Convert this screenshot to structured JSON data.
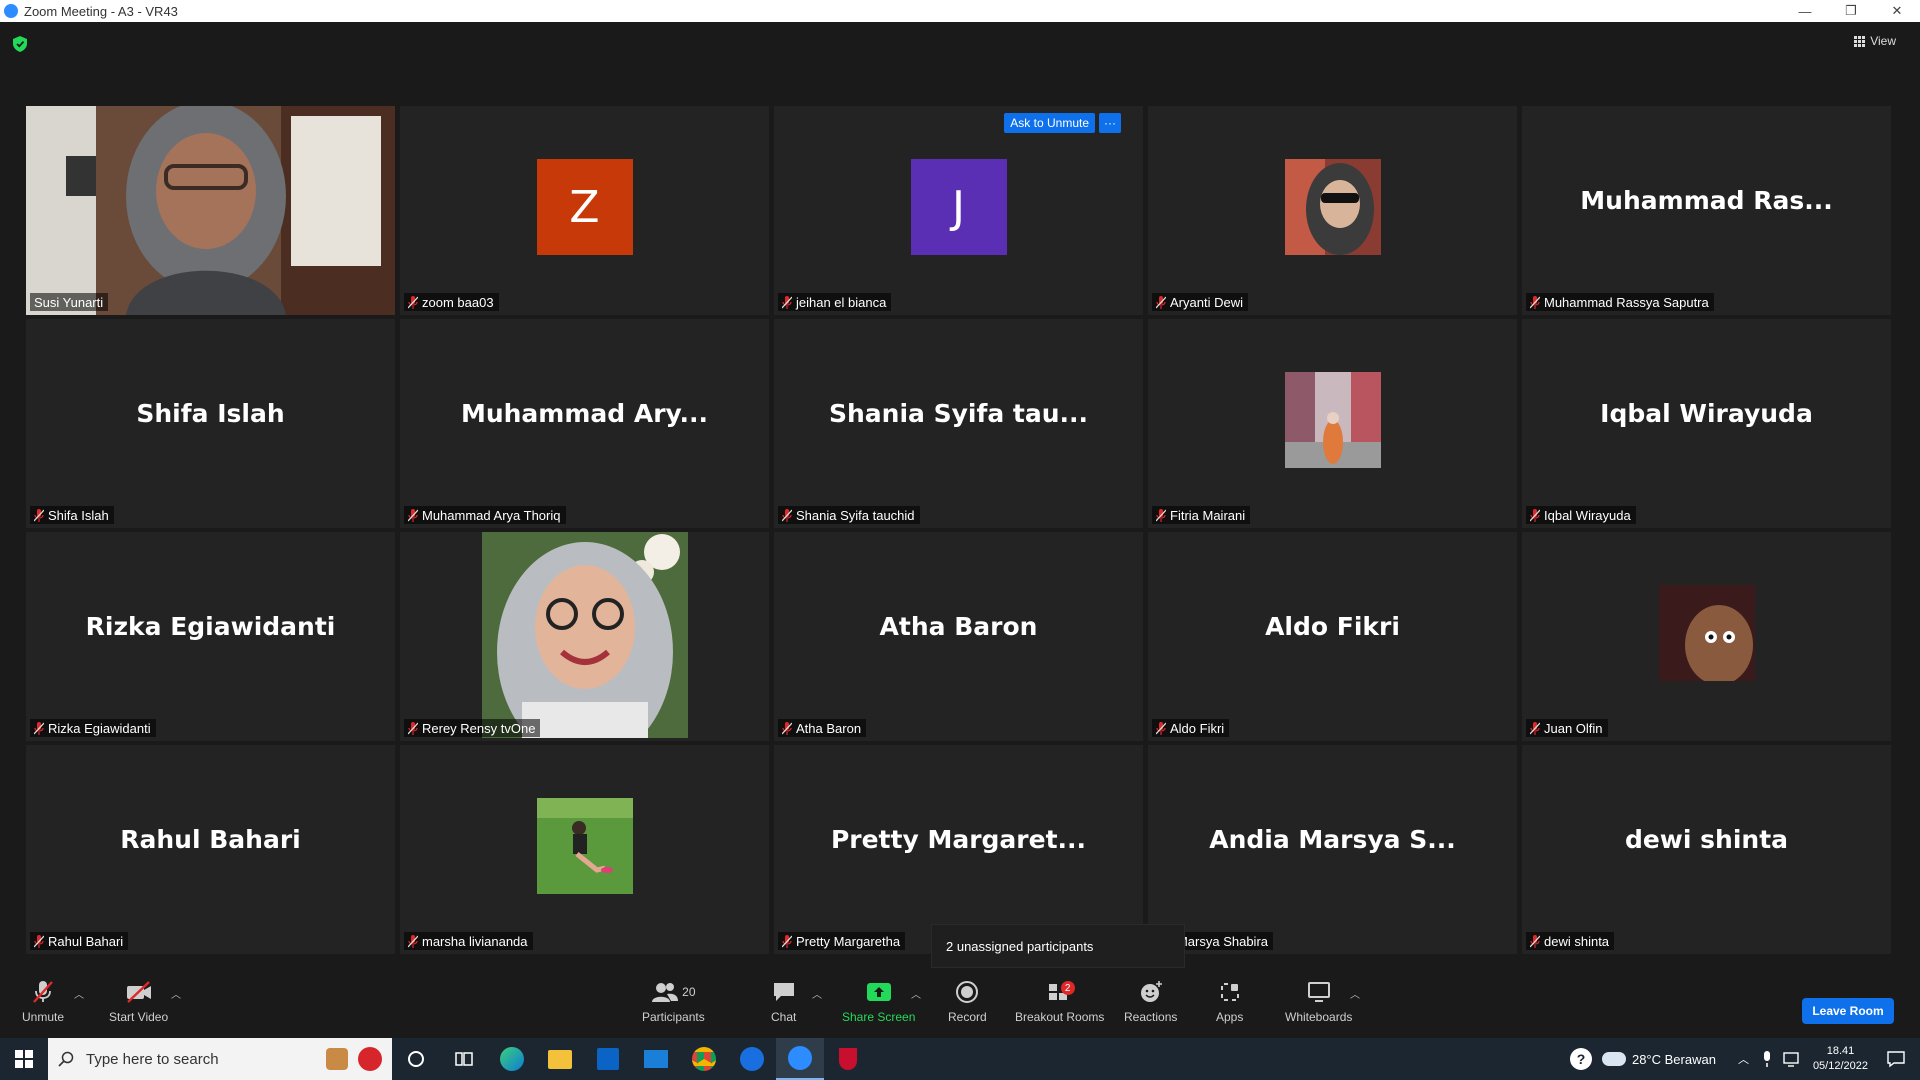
{
  "window": {
    "title": "Zoom Meeting - A3 - VR43",
    "minimize": "—",
    "restore": "❐",
    "close": "✕"
  },
  "view_label": "View",
  "tile_actions": {
    "ask_to_unmute": "Ask to Unmute",
    "more": "···"
  },
  "participants": [
    {
      "name": "Susi Yunarti",
      "display": "",
      "avatar_letter": "",
      "avatar_color": "",
      "muted": false,
      "active_speaker": true,
      "photo": "video"
    },
    {
      "name": "zoom baa03",
      "display": "",
      "avatar_letter": "Z",
      "avatar_color": "#c8390a",
      "muted": true,
      "photo": ""
    },
    {
      "name": "jeihan el bianca",
      "display": "",
      "avatar_letter": "J",
      "avatar_color": "#5b2fb4",
      "muted": true,
      "photo": ""
    },
    {
      "name": "Aryanti Dewi",
      "display": "",
      "avatar_letter": "",
      "avatar_color": "",
      "muted": true,
      "photo": "selfie"
    },
    {
      "name": "Muhammad Rassya Saputra",
      "display": "Muhammad  Ras...",
      "avatar_letter": "",
      "avatar_color": "",
      "muted": true,
      "photo": ""
    },
    {
      "name": "Shifa Islah",
      "display": "Shifa Islah",
      "avatar_letter": "",
      "avatar_color": "",
      "muted": true,
      "photo": ""
    },
    {
      "name": "Muhammad Arya Thoriq",
      "display": "Muhammad  Ary...",
      "avatar_letter": "",
      "avatar_color": "",
      "muted": true,
      "photo": ""
    },
    {
      "name": "Shania Syifa tauchid",
      "display": "Shania Syifa tau...",
      "avatar_letter": "",
      "avatar_color": "",
      "muted": true,
      "photo": ""
    },
    {
      "name": "Fitria Mairani",
      "display": "",
      "avatar_letter": "",
      "avatar_color": "",
      "muted": true,
      "photo": "street"
    },
    {
      "name": "Iqbal Wirayuda",
      "display": "Iqbal Wirayuda",
      "avatar_letter": "",
      "avatar_color": "",
      "muted": true,
      "photo": ""
    },
    {
      "name": "Rizka Egiawidanti",
      "display": "Rizka Egiawidanti",
      "avatar_letter": "",
      "avatar_color": "",
      "muted": true,
      "photo": ""
    },
    {
      "name": "Rerey Rensy tvOne",
      "display": "",
      "avatar_letter": "",
      "avatar_color": "",
      "muted": true,
      "photo": "portrait"
    },
    {
      "name": "Atha Baron",
      "display": "Atha Baron",
      "avatar_letter": "",
      "avatar_color": "",
      "muted": true,
      "photo": ""
    },
    {
      "name": "Aldo Fikri",
      "display": "Aldo Fikri",
      "avatar_letter": "",
      "avatar_color": "",
      "muted": true,
      "photo": ""
    },
    {
      "name": "Juan Olfin",
      "display": "",
      "avatar_letter": "",
      "avatar_color": "",
      "muted": true,
      "photo": "face"
    },
    {
      "name": "Rahul Bahari",
      "display": "Rahul Bahari",
      "avatar_letter": "",
      "avatar_color": "",
      "muted": true,
      "photo": ""
    },
    {
      "name": "marsha liviananda",
      "display": "",
      "avatar_letter": "",
      "avatar_color": "",
      "muted": true,
      "photo": "grass"
    },
    {
      "name": "Pretty Margaretha",
      "display": "Pretty  Margaret...",
      "avatar_letter": "",
      "avatar_color": "",
      "muted": true,
      "photo": ""
    },
    {
      "name": "dia Marsya Shabira",
      "display": "Andia Marsya S...",
      "avatar_letter": "",
      "avatar_color": "",
      "muted": false,
      "photo": ""
    },
    {
      "name": "dewi shinta",
      "display": "dewi shinta",
      "avatar_letter": "",
      "avatar_color": "",
      "muted": true,
      "photo": ""
    }
  ],
  "tooltip": "2 unassigned participants",
  "toolbar": {
    "unmute": "Unmute",
    "start_video": "Start Video",
    "participants": "Participants",
    "participants_count": "20",
    "chat": "Chat",
    "share_screen": "Share Screen",
    "record": "Record",
    "breakout_rooms": "Breakout Rooms",
    "breakout_badge": "2",
    "reactions": "Reactions",
    "apps": "Apps",
    "whiteboards": "Whiteboards",
    "leave_room": "Leave Room"
  },
  "taskbar": {
    "search_placeholder": "Type here to search",
    "weather": "28°C  Berawan",
    "time": "18.41",
    "date": "05/12/2022"
  },
  "colors": {
    "accent": "#0e71eb",
    "active_speaker_border": "#e8e27a",
    "share_green": "#23d959",
    "mute_red": "#e02828"
  }
}
